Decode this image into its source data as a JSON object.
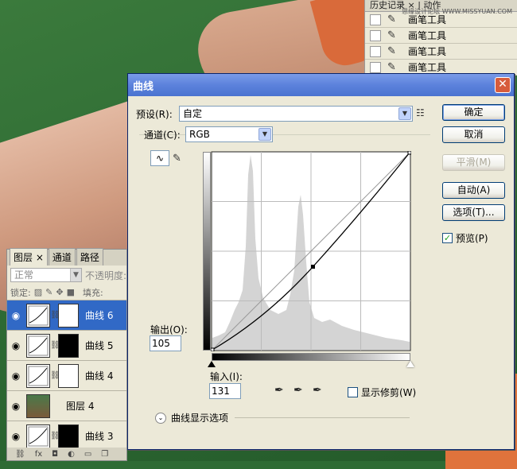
{
  "history": {
    "tabs": "历史记录 × | 动作",
    "watermark": "思缘设计论坛 WWW.MISSYUAN.COM",
    "items": [
      "画笔工具",
      "画笔工具",
      "画笔工具",
      "画笔工具"
    ]
  },
  "layers": {
    "tabs": [
      "图层 ×",
      "通道",
      "路径"
    ],
    "blend_mode": "正常",
    "opacity_label": "不透明度:",
    "lock_label": "锁定:",
    "fill_label": "填充:",
    "rows": [
      {
        "name": "曲线 6",
        "kind": "curve",
        "mask": "white",
        "selected": true
      },
      {
        "name": "曲线 5",
        "kind": "curve",
        "mask": "dark",
        "selected": false
      },
      {
        "name": "曲线 4",
        "kind": "curve",
        "mask": "white",
        "selected": false
      },
      {
        "name": "图层 4",
        "kind": "photo",
        "mask": "none",
        "selected": false
      },
      {
        "name": "曲线 3",
        "kind": "curve",
        "mask": "dark",
        "selected": false
      }
    ],
    "footer_icons": [
      "link-icon",
      "fx-icon",
      "mask-icon",
      "adjust-icon",
      "folder-icon",
      "new-icon",
      "trash-icon"
    ]
  },
  "dialog": {
    "title": "曲线",
    "preset_label": "预设(R):",
    "preset_value": "自定",
    "channel_label": "通道(C):",
    "channel_value": "RGB",
    "buttons": {
      "ok": "确定",
      "cancel": "取消",
      "smooth": "平滑(M)",
      "auto": "自动(A)",
      "options": "选项(T)..."
    },
    "preview_label": "预览(P)",
    "output_label": "输出(O):",
    "output_value": "105",
    "input_label": "输入(I):",
    "input_value": "131",
    "clip_label": "显示修剪(W)",
    "curve_display_label": "曲线显示选项"
  }
}
